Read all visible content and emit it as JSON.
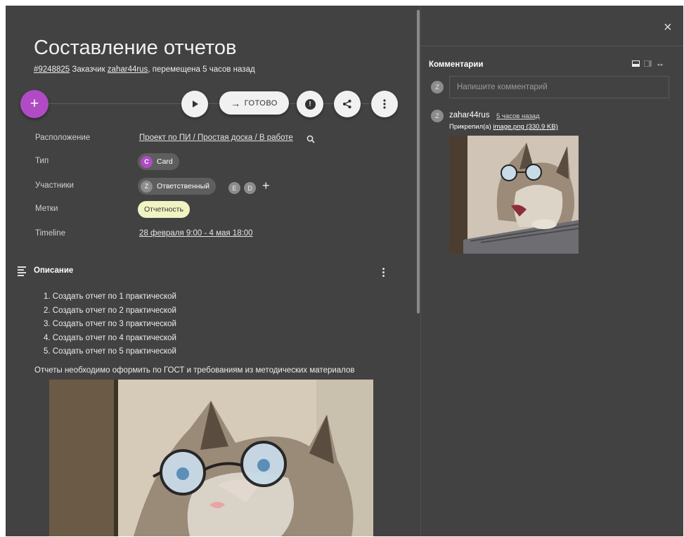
{
  "card": {
    "title": "Составление отчетов",
    "id": "#9248825",
    "subtitle_pre": " Заказчик ",
    "customer": "zahar44rus",
    "subtitle_post": ", перемещена 5 часов назад"
  },
  "actions": {
    "add": "+",
    "done_arrow": "→",
    "done_label": "ГОТОВО",
    "alert_glyph": "!"
  },
  "props": {
    "location_label": "Расположение",
    "location_value": "Проект по ПИ / Простая доска / В работе",
    "type_label": "Тип",
    "type_initial": "C",
    "type_value": "Card",
    "members_label": "Участники",
    "responsible_initial": "Z",
    "responsible_label": "Ответственный",
    "member_e": "E",
    "member_d": "D",
    "add_member": "+",
    "tags_label": "Метки",
    "tag_value": "Отчетность",
    "timeline_label": "Timeline",
    "timeline_value": "28 февраля 9:00 - 4 мая 18:00"
  },
  "description": {
    "title": "Описание",
    "items": [
      "1. Создать отчет по 1 практической",
      "2. Создать отчет по 2 практической",
      "3. Создать отчет по 3 практической",
      "4. Создать отчет по 4 практической",
      "5. Создать отчет по 5 практической"
    ],
    "note": "Отчеты необходимо оформить по ГОСТ и требованиям из методических материалов"
  },
  "comments": {
    "close": "×",
    "title": "Комментарии",
    "view_toggle": "↔",
    "user_initial": "Z",
    "placeholder": "Напишите комментарий",
    "items": [
      {
        "initial": "Z",
        "author": "zahar44rus",
        "time": "5 часов назад",
        "attach_pre": "Прикрепил(а) ",
        "attach_link": "image.png (330.9 KB)"
      }
    ]
  },
  "colors": {
    "panel_bg": "#424242",
    "accent_purple": "#b04bc5",
    "tag_bg": "#f0f4c3",
    "chip_bg": "#5e5e5e"
  },
  "icons": [
    "add-icon",
    "play-icon",
    "arrow-right-icon",
    "alert-icon",
    "share-icon",
    "more-vert-icon",
    "search-icon",
    "description-icon",
    "close-icon",
    "view-bottom-icon",
    "view-side-icon",
    "expand-horizontal-icon"
  ]
}
